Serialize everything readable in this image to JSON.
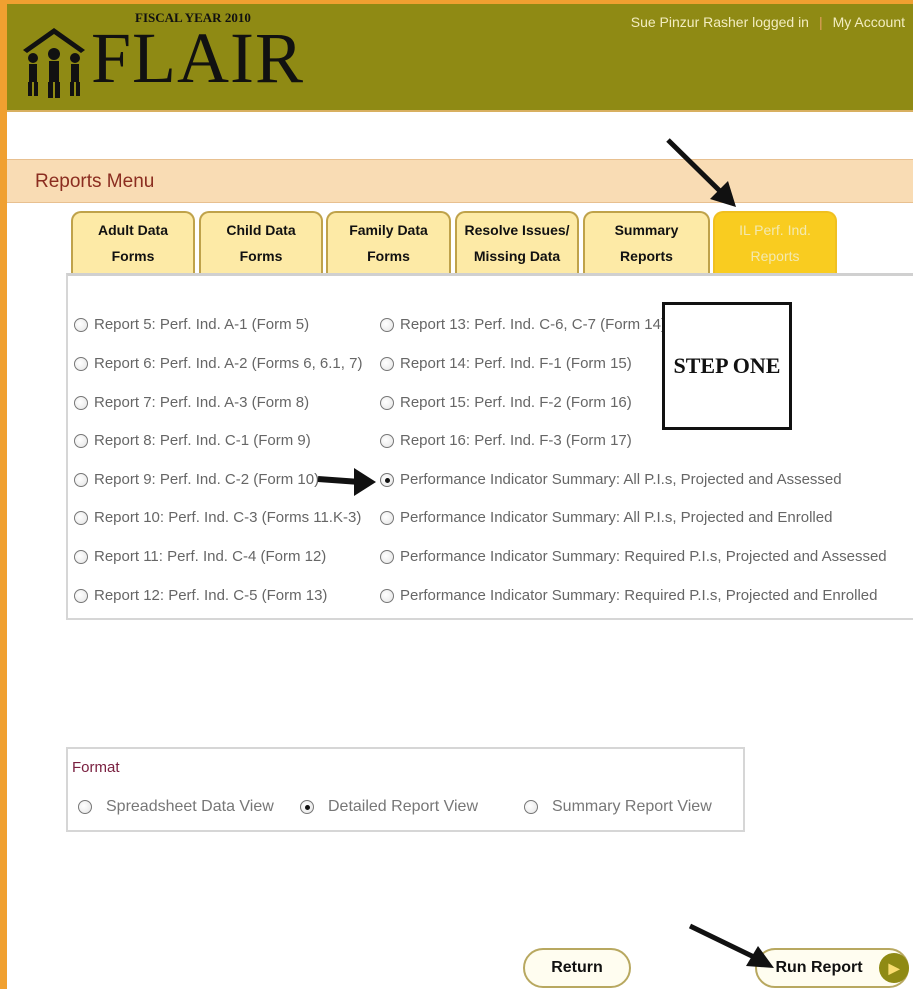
{
  "header": {
    "fiscal_year": "FISCAL YEAR 2010",
    "logo_text": "FLAIR",
    "user_text": "Sue Pinzur Rasher logged in",
    "separator": "|",
    "account_link": "My Account"
  },
  "menu": {
    "title": "Reports Menu"
  },
  "tabs": [
    {
      "label": "Adult Data Forms"
    },
    {
      "label": "Child Data Forms"
    },
    {
      "label": "Family Data Forms"
    },
    {
      "label": "Resolve Issues/\nMissing Data"
    },
    {
      "label": "Summary Reports"
    },
    {
      "label": "IL Perf. Ind.\nReports"
    }
  ],
  "reports_left": [
    {
      "label": "Report 5: Perf. Ind. A-1 (Form 5)",
      "checked": false
    },
    {
      "label": "Report 6: Perf. Ind. A-2 (Forms 6, 6.1, 7)",
      "checked": false
    },
    {
      "label": "Report 7: Perf. Ind. A-3 (Form 8)",
      "checked": false
    },
    {
      "label": "Report 8: Perf. Ind. C-1 (Form 9)",
      "checked": false
    },
    {
      "label": "Report 9: Perf. Ind. C-2 (Form 10)",
      "checked": false
    },
    {
      "label": "Report 10: Perf. Ind. C-3 (Forms 11.K-3)",
      "checked": false
    },
    {
      "label": "Report 11: Perf. Ind. C-4 (Form 12)",
      "checked": false
    },
    {
      "label": "Report 12: Perf. Ind. C-5 (Form 13)",
      "checked": false
    }
  ],
  "reports_right": [
    {
      "label": "Report 13: Perf. Ind. C-6, C-7 (Form 14)",
      "checked": false
    },
    {
      "label": "Report 14: Perf. Ind. F-1 (Form 15)",
      "checked": false
    },
    {
      "label": "Report 15: Perf. Ind. F-2 (Form 16)",
      "checked": false
    },
    {
      "label": "Report 16: Perf. Ind. F-3 (Form 17)",
      "checked": false
    },
    {
      "label": "Performance Indicator Summary: All P.I.s, Projected and Assessed",
      "checked": true
    },
    {
      "label": "Performance Indicator Summary: All P.I.s, Projected and Enrolled",
      "checked": false
    },
    {
      "label": "Performance Indicator Summary: Required P.I.s, Projected and Assessed",
      "checked": false
    },
    {
      "label": "Performance Indicator Summary: Required P.I.s, Projected and Enrolled",
      "checked": false
    }
  ],
  "step_label": "STEP ONE",
  "format": {
    "label": "Format",
    "options": [
      {
        "label": "Spreadsheet Data View",
        "checked": false
      },
      {
        "label": "Detailed Report View",
        "checked": true
      },
      {
        "label": "Summary Report View",
        "checked": false
      }
    ]
  },
  "buttons": {
    "return_label": "Return",
    "run_label": "Run Report",
    "run_icon": "play-icon"
  },
  "colors": {
    "header_bg": "#8f8a14",
    "menu_band": "#f9dcb4",
    "tab_bg": "#fdeaa6",
    "tab_active": "#f9cc20",
    "menu_title": "#8b2d20"
  }
}
